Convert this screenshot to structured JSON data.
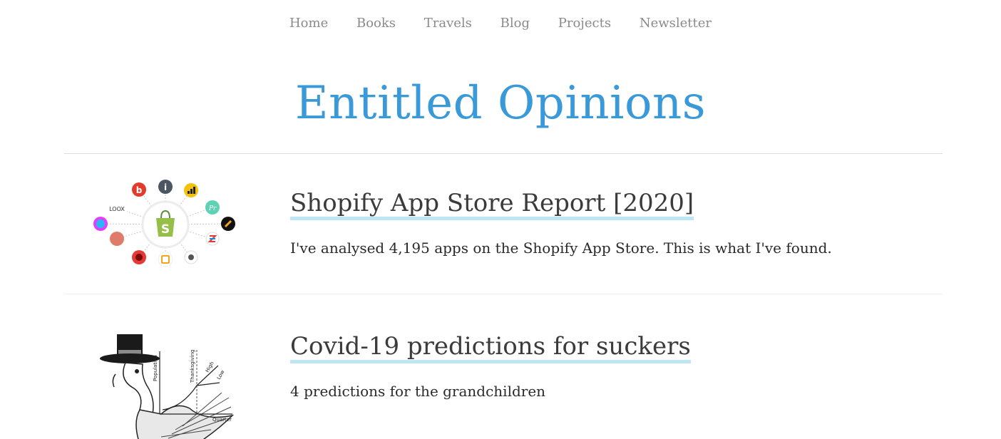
{
  "nav": {
    "items": [
      "Home",
      "Books",
      "Travels",
      "Blog",
      "Projects",
      "Newsletter"
    ]
  },
  "site": {
    "title": "Entitled Opinions"
  },
  "posts": [
    {
      "title": "Shopify App Store Report [2020]",
      "excerpt": "I've analysed 4,195 apps on the Shopify App Store. This is what I've found.",
      "thumbnail": {
        "icon": "shopify-app-ecosystem-diagram",
        "labels": [
          "LOOX"
        ]
      }
    },
    {
      "title": "Covid-19 predictions for suckers",
      "excerpt": "4 predictions for the grandchildren",
      "thumbnail": {
        "icon": "turkey-pilgrim-chart-illustration",
        "labels": [
          "Population",
          "Thanksgiving",
          "High",
          "Low",
          "Quarter"
        ]
      }
    }
  ],
  "colors": {
    "title_blue": "#3a99d8",
    "link_underline": "#bde6f4",
    "nav_gray": "#8a8a8a",
    "shopify_green": "#95bf47"
  }
}
